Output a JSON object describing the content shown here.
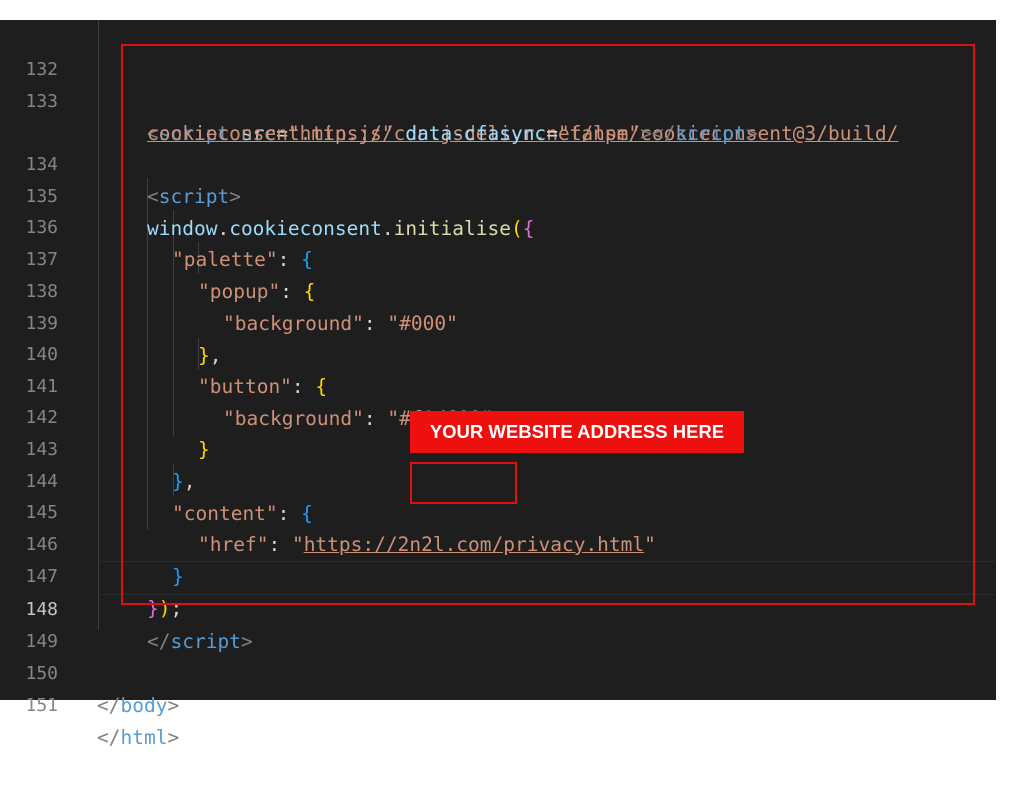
{
  "line_numbers": [
    "132",
    "133",
    "",
    "134",
    "135",
    "136",
    "137",
    "138",
    "139",
    "140",
    "141",
    "142",
    "143",
    "144",
    "145",
    "146",
    "147",
    "148",
    "149",
    "150",
    "151"
  ],
  "code": {
    "l133a_open": "<",
    "l133a_tag": "script",
    "l133a_attr1": "src",
    "l133a_eq": "=",
    "l133a_url1": "\"https://cdn.jsdelivr.net/npm/cookieconsent@3/build/",
    "l133b_url2": "cookieconsent.min.js\"",
    "l133b_attr2": "data-cfasync",
    "l133b_eq": "=",
    "l133b_val": "\"false\"",
    "l133b_close": ">",
    "l133b_end_open": "</",
    "l133b_end_tag": "script",
    "l133b_end_close": ">",
    "l134_open": "<",
    "l134_tag": "script",
    "l134_close": ">",
    "l135_window": "window",
    "l135_dot1": ".",
    "l135_cc": "cookieconsent",
    "l135_dot2": ".",
    "l135_fn": "initialise",
    "l135_paren": "(",
    "l135_brace": "{",
    "l136_key": "\"palette\"",
    "l136_colon": ": ",
    "l136_brace": "{",
    "l137_key": "\"popup\"",
    "l137_colon": ": ",
    "l137_brace": "{",
    "l138_key": "\"background\"",
    "l138_colon": ": ",
    "l138_val": "\"#000\"",
    "l139_brace": "}",
    "l139_comma": ",",
    "l140_key": "\"button\"",
    "l140_colon": ": ",
    "l140_brace": "{",
    "l141_key": "\"background\"",
    "l141_colon": ": ",
    "l141_val": "\"#f1d600\"",
    "l142_brace": "}",
    "l143_brace": "}",
    "l143_comma": ",",
    "l144_key": "\"content\"",
    "l144_colon": ": ",
    "l144_brace": "{",
    "l145_key": "\"href\"",
    "l145_colon": ": ",
    "l145_q1": "\"",
    "l145_url": "https://2n2l.com/privacy.html",
    "l145_q2": "\"",
    "l146_brace": "}",
    "l147_brace": "}",
    "l147_paren": ")",
    "l147_semi": ";",
    "l148_open": "</",
    "l148_tag": "script",
    "l148_close": ">",
    "l150_open": "</",
    "l150_tag": "body",
    "l150_close": ">",
    "l151_open": "</",
    "l151_tag": "html",
    "l151_close": ">"
  },
  "annotation": {
    "callout_text": "YOUR WEBSITE ADDRESS HERE",
    "box_color": "#e01010",
    "callout_color": "#ee0f0f"
  }
}
